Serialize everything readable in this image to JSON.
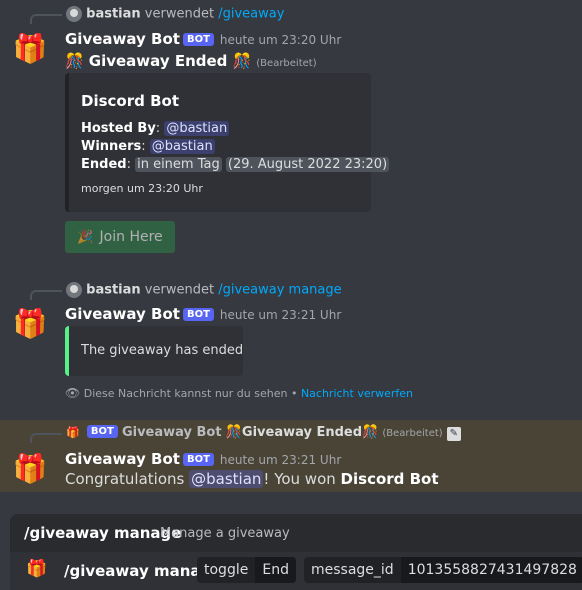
{
  "msg1": {
    "ref_user": "bastian",
    "ref_verb": "verwendet",
    "ref_command": "/giveaway",
    "username": "Giveaway Bot",
    "badge": "BOT",
    "time": "heute um 23:20 Uhr",
    "heading": "Giveaway Ended",
    "edited": "(Bearbeitet)",
    "embed": {
      "title": "Discord Bot",
      "hosted_label": "Hosted By",
      "hosted_value": "@bastian",
      "winners_label": "Winners",
      "winners_value": "@bastian",
      "ended_label": "Ended",
      "ended_relative": "in einem Tag",
      "ended_date": "29. August 2022 23:20",
      "footer": "morgen um 23:20 Uhr"
    },
    "button": "Join Here"
  },
  "msg2": {
    "ref_user": "bastian",
    "ref_verb": "verwendet",
    "ref_command": "/giveaway manage",
    "username": "Giveaway Bot",
    "badge": "BOT",
    "time": "heute um 23:21 Uhr",
    "embed_text": "The giveaway has ended",
    "ephemeral_text": "Diese Nachricht kannst nur du sehen •",
    "dismiss_link": "Nachricht verwerfen"
  },
  "msg3": {
    "ref_badge": "BOT",
    "ref_user": "Giveaway Bot",
    "ref_text": "Giveaway Ended",
    "ref_edited": "(Bearbeitet)",
    "username": "Giveaway Bot",
    "badge": "BOT",
    "time": "heute um 23:21 Uhr",
    "text_pre": "Congratulations",
    "mention": "@bastian",
    "text_mid": "! You won",
    "prize": "Discord Bot"
  },
  "command_bar": {
    "title": "/giveaway manage",
    "description": "Manage a giveaway",
    "input_command": "/giveaway manage",
    "option1_name": "toggle",
    "option1_value": "End",
    "option2_name": "message_id",
    "option2_value": "1013558827431497828"
  },
  "icons": {
    "avatar": "gift-icon",
    "heading": "confetti-icon",
    "button": "party-popper-icon",
    "edit": "pencil-icon",
    "eye": "eye-icon"
  },
  "colors": {
    "background": "#36393f",
    "embed": "#2f3136",
    "bot_badge": "#5865f2",
    "join_button": "#2d7d46",
    "highlight_row": "#4a4437",
    "accent_bar": "#57f287"
  }
}
